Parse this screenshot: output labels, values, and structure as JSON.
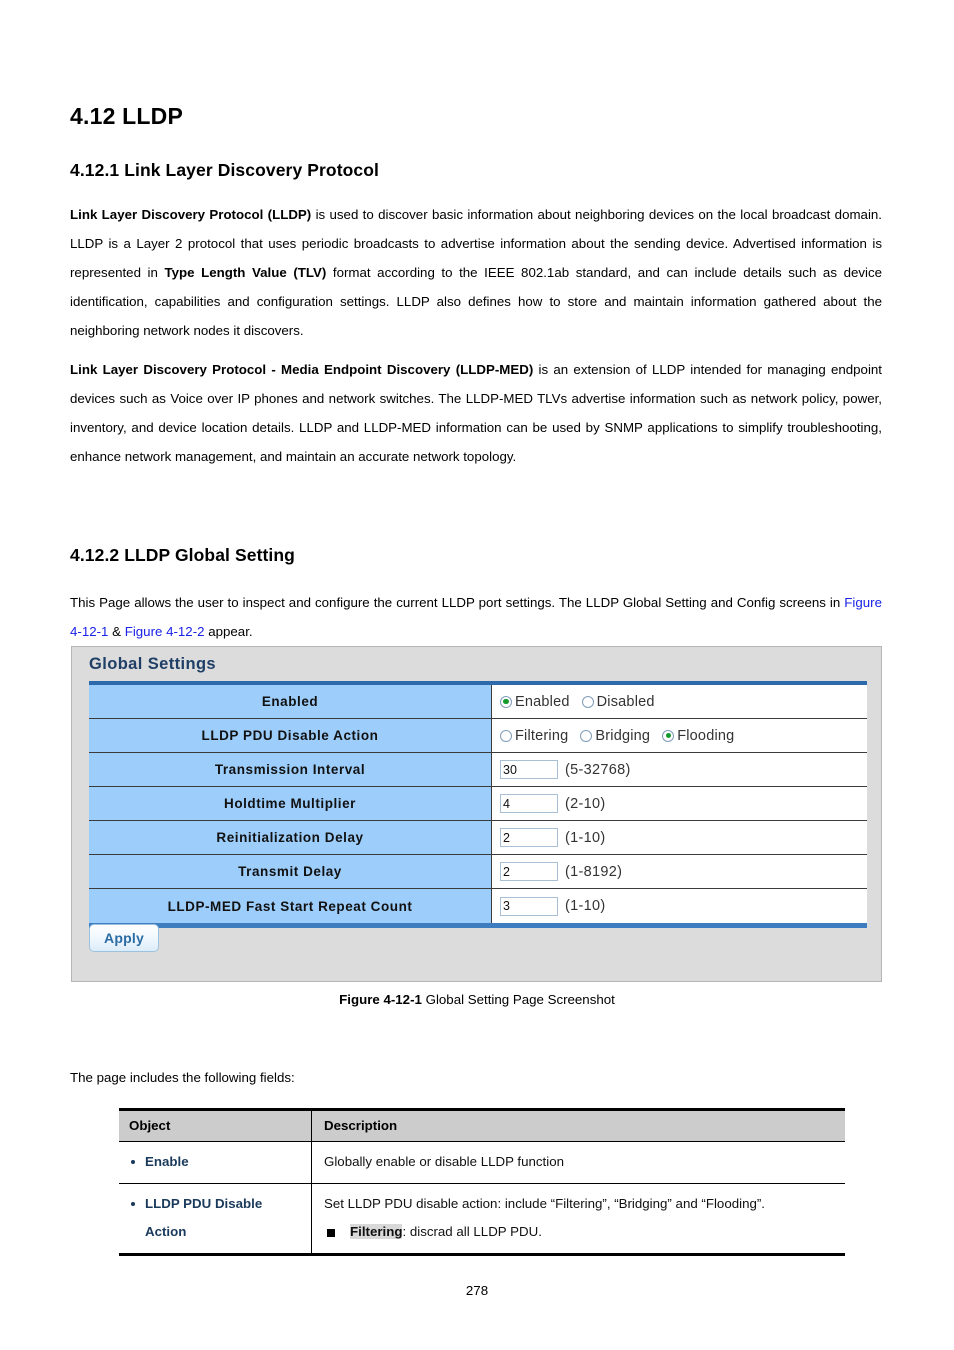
{
  "document": {
    "section_number": "4.12",
    "section_title": "4.12 LLDP",
    "subsection_1_title": "4.12.1 Link Layer Discovery Protocol",
    "subsection_2_title": "4.12.2 LLDP Global Setting",
    "page_number": "278"
  },
  "paragraphs": {
    "p1_bold_lead": "Link Layer Discovery Protocol (LLDP)",
    "p1_rest": " is used to discover basic information about neighboring devices on the local broadcast domain. LLDP is a Layer 2 protocol that uses periodic broadcasts to advertise information about the sending device. Advertised information is represented in ",
    "p1_bold_mid": "Type Length Value (TLV)",
    "p1_tail": " format according to the IEEE 802.1ab standard, and can include details such as device identification, capabilities and configuration settings. LLDP also defines how to store and maintain information gathered about the neighboring network nodes it discovers.",
    "p2_bold_lead": "Link Layer Discovery Protocol - Media Endpoint Discovery (LLDP-MED)",
    "p2_rest": " is an extension of LLDP intended for managing endpoint devices such as Voice over IP phones and network switches. The LLDP-MED TLVs advertise information such as network policy, power, inventory, and device location details. LLDP and LLDP-MED information can be used by SNMP applications to simplify troubleshooting, enhance network management, and maintain an accurate network topology.",
    "p3_part1": "This Page allows the user to inspect and configure the current LLDP port settings. The LLDP Global Setting and Config screens in ",
    "p3_link1": "Figure 4-12-1",
    "p3_amp": " & ",
    "p3_link2": "Figure 4-12-2",
    "p3_part2": " appear.",
    "p4": "The page includes the following fields:"
  },
  "screenshot": {
    "panel_title": "Global Settings",
    "rows": [
      {
        "label": "Enabled",
        "type": "radio",
        "options": [
          {
            "label": "Enabled",
            "selected": true
          },
          {
            "label": "Disabled",
            "selected": false
          }
        ]
      },
      {
        "label": "LLDP PDU Disable Action",
        "type": "radio",
        "options": [
          {
            "label": "Filtering",
            "selected": false
          },
          {
            "label": "Bridging",
            "selected": false
          },
          {
            "label": "Flooding",
            "selected": true
          }
        ]
      },
      {
        "label": "Transmission Interval",
        "type": "text",
        "value": "30",
        "range": "(5-32768)"
      },
      {
        "label": "Holdtime Multiplier",
        "type": "text",
        "value": "4",
        "range": "(2-10)"
      },
      {
        "label": "Reinitialization Delay",
        "type": "text",
        "value": "2",
        "range": "(1-10)"
      },
      {
        "label": "Transmit Delay",
        "type": "text",
        "value": "2",
        "range": "(1-8192)"
      },
      {
        "label": "LLDP-MED Fast Start Repeat Count",
        "type": "text",
        "value": "3",
        "range": "(1-10)"
      }
    ],
    "apply_label": "Apply"
  },
  "figure_caption": {
    "bold": "Figure 4-12-1",
    "text": " Global Setting Page Screenshot"
  },
  "object_table": {
    "headers": {
      "object": "Object",
      "description": "Description"
    },
    "rows": [
      {
        "object": "Enable",
        "object_line2": "",
        "desc_main": "Globally enable or disable LLDP function",
        "desc_sub_bold": "",
        "desc_sub_rest": ""
      },
      {
        "object": "LLDP PDU Disable",
        "object_line2": "Action",
        "desc_main": "Set LLDP PDU disable action: include “Filtering”, “Bridging” and “Flooding”.",
        "desc_sub_bold": "Filtering",
        "desc_sub_rest": ": discrad all LLDP PDU."
      }
    ]
  },
  "colors": {
    "link": "#1a23e8",
    "panel_bg": "#dcdcdc",
    "table_label_bg": "#9ccdfb",
    "table_border_top": "#2d6aab",
    "radio_selected": "#139a2f",
    "object_text": "#1a3a5c",
    "header_bg": "#cccccc"
  }
}
